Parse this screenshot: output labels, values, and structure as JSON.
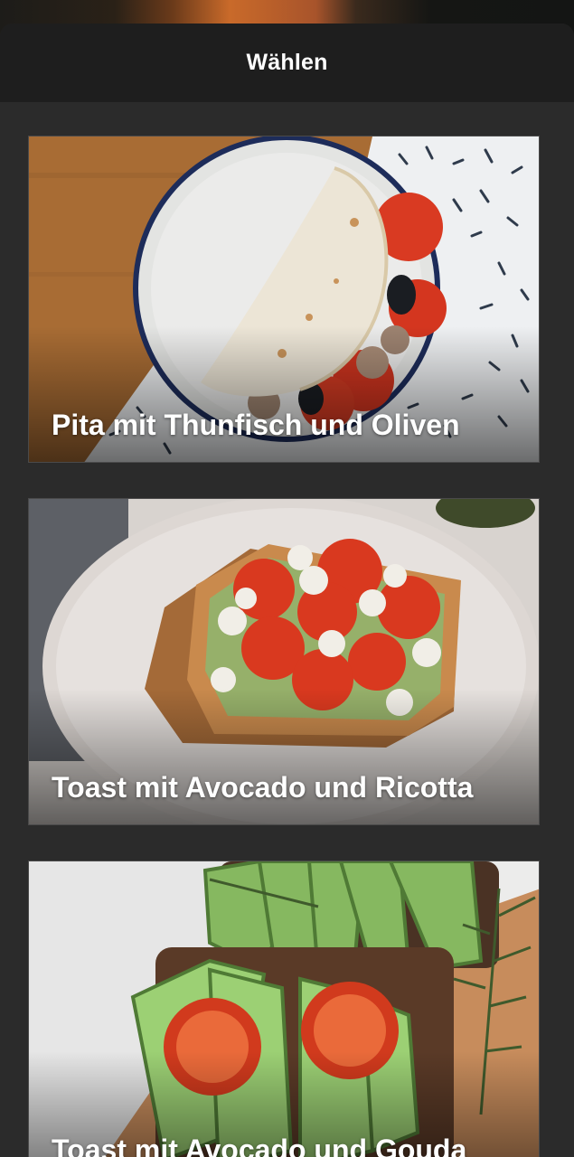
{
  "header": {
    "title": "Wählen"
  },
  "recipes": [
    {
      "title": "Pita mit Thunfisch und Oliven"
    },
    {
      "title": "Toast mit Avocado und Ricotta"
    },
    {
      "title": "Toast mit Avocado und Gouda"
    }
  ],
  "colors": {
    "header_bg": "#1e1e1e",
    "sheet_bg": "#2b2b2b",
    "text": "#ffffff"
  }
}
